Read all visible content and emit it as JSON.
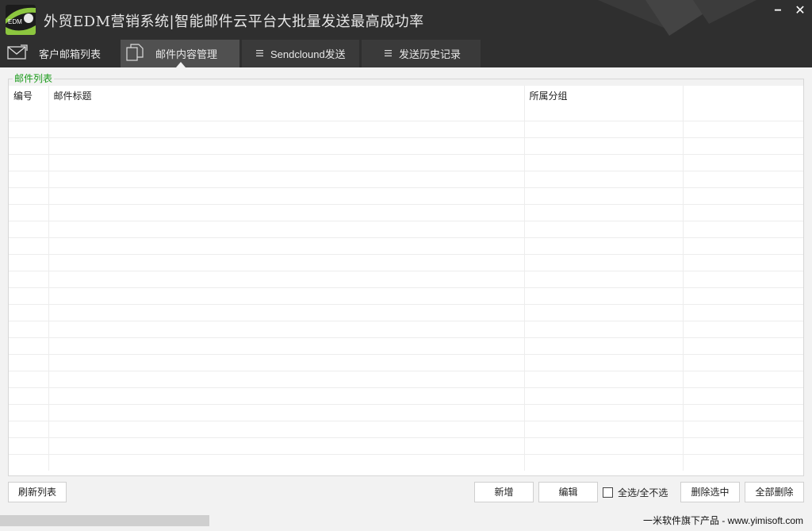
{
  "app": {
    "logo_text": "EDM",
    "title": "外贸EDM营销系统|智能邮件云平台大批量发送最高成功率",
    "minimize_label": "−",
    "close_label": "✕"
  },
  "tabs": [
    {
      "label": "客户邮箱列表",
      "icon": "mail-icon",
      "active": false
    },
    {
      "label": "邮件内容管理",
      "icon": "documents-icon",
      "active": true
    },
    {
      "label": "Sendclound发送",
      "icon": "list-icon",
      "active": false
    },
    {
      "label": "发送历史记录",
      "icon": "list-icon",
      "active": false
    }
  ],
  "mail_list": {
    "group_label": "邮件列表",
    "columns": [
      "编号",
      "邮件标题",
      "所属分组",
      ""
    ],
    "rows": []
  },
  "actions": {
    "refresh_label": "刷新列表",
    "add_label": "新增",
    "edit_label": "编辑",
    "select_all_label": "全选/全不选",
    "select_all_checked": false,
    "delete_selected_label": "删除选中",
    "delete_all_label": "全部删除"
  },
  "status": {
    "footer_text": "一米软件旗下产品 - www.yimisoft.com"
  },
  "colors": {
    "titlebar": "#2f2f2f",
    "active_tab": "#505050",
    "group_label": "#1a9a1a",
    "logo_accent": "#8cc63f"
  }
}
